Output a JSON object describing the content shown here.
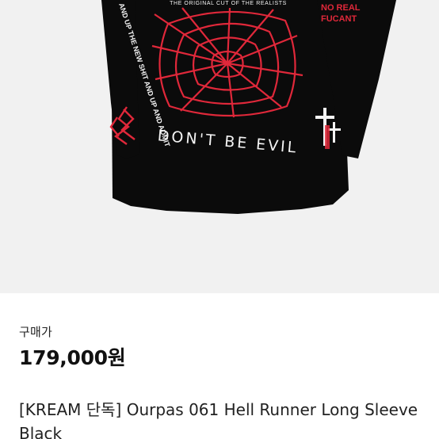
{
  "product": {
    "image_alt": "Ourpas 061 Hell Runner Long Sleeve Black",
    "print": {
      "top_text": "THE ORIGINAL CUT OF THE REALISTS",
      "slogan": "DON'T BE EVIL",
      "right_text_1": "NO REAL",
      "right_text_2": "FUCANT",
      "left_sleeve_text": "AND UP THE NEW SHIT AND UP AND ADMIT"
    },
    "colors": {
      "background": "#f1f1f1",
      "shirt": "#0b0b0b",
      "print_red": "#e0283a",
      "print_white": "#f4f4f4"
    }
  },
  "price": {
    "label": "구매가",
    "value": "179,000원"
  },
  "title": "[KREAM 단독] Ourpas 061 Hell Runner Long Sleeve Black"
}
